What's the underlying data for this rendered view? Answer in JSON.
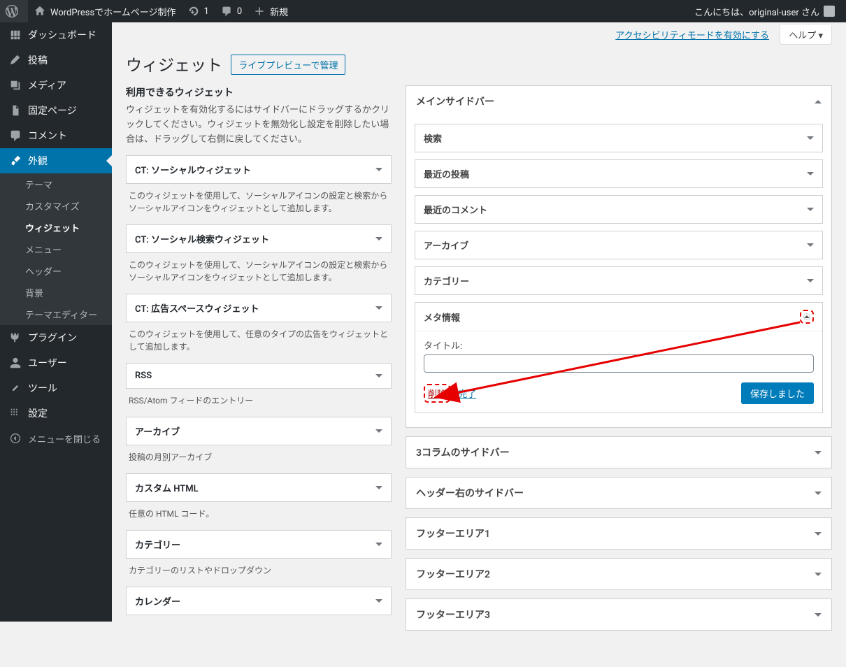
{
  "adminbar": {
    "site_title": "WordPressでホームページ制作",
    "update_count": "1",
    "comment_count": "0",
    "new_label": "新規",
    "greeting_prefix": "こんにちは、",
    "username": "original-user さん"
  },
  "menu": {
    "dashboard": "ダッシュボード",
    "posts": "投稿",
    "media": "メディア",
    "pages": "固定ページ",
    "comments": "コメント",
    "appearance": "外観",
    "appearance_sub": {
      "themes": "テーマ",
      "customize": "カスタマイズ",
      "widgets": "ウィジェット",
      "menus": "メニュー",
      "header": "ヘッダー",
      "background": "背景",
      "editor": "テーマエディター"
    },
    "plugins": "プラグイン",
    "users": "ユーザー",
    "tools": "ツール",
    "settings": "設定",
    "collapse": "メニューを閉じる"
  },
  "page": {
    "accessibility": "アクセシビリティモードを有効にする",
    "help": "ヘルプ ▾",
    "title": "ウィジェット",
    "preview_button": "ライブプレビューで管理"
  },
  "available": {
    "title": "利用できるウィジェット",
    "desc": "ウィジェットを有効化するにはサイドバーにドラッグするかクリックしてください。ウィジェットを無効化し設定を削除したい場合は、ドラッグして右側に戻してください。",
    "items": [
      {
        "name": "CT: ソーシャルウィジェット",
        "desc": "このウィジェットを使用して、ソーシャルアイコンの設定と検索からソーシャルアイコンをウィジェットとして追加します。"
      },
      {
        "name": "CT: ソーシャル検索ウィジェット",
        "desc": "このウィジェットを使用して、ソーシャルアイコンの設定と検索からソーシャルアイコンをウィジェットとして追加します。"
      },
      {
        "name": "CT: 広告スペースウィジェット",
        "desc": "このウィジェットを使用して、任意のタイプの広告をウィジェットとして追加します。"
      },
      {
        "name": "RSS",
        "desc": "RSS/Atom フィードのエントリー"
      },
      {
        "name": "アーカイブ",
        "desc": "投稿の月別アーカイブ"
      },
      {
        "name": "カスタム HTML",
        "desc": "任意の HTML コード。"
      },
      {
        "name": "カテゴリー",
        "desc": "カテゴリーのリストやドロップダウン"
      },
      {
        "name": "カレンダー",
        "desc": ""
      }
    ]
  },
  "sidebar_main": {
    "title": "メインサイドバー",
    "widgets": [
      "検索",
      "最近の投稿",
      "最近のコメント",
      "アーカイブ",
      "カテゴリー"
    ],
    "meta": {
      "title": "メタ情報",
      "label_title": "タイトル:",
      "value": "",
      "delete": "削除",
      "done": "完了",
      "saved": "保存しました"
    }
  },
  "other_sidebars": [
    "3コラムのサイドバー",
    "ヘッダー右のサイドバー",
    "フッターエリア1",
    "フッターエリア2",
    "フッターエリア3"
  ]
}
